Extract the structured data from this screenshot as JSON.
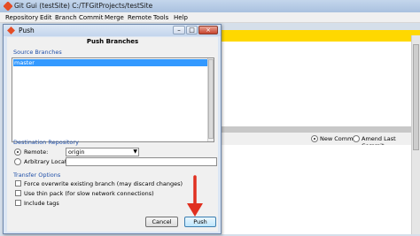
{
  "main_window": {
    "title": "Git Gui (testSite) C:/TFGitProjects/testSite",
    "menu": [
      "Repository",
      "Edit",
      "Branch",
      "Commit",
      "Merge",
      "Remote",
      "Tools",
      "Help"
    ],
    "new_commit_label": "New Commit",
    "amend_label": "Amend Last Commit"
  },
  "dialog": {
    "title": "Push",
    "heading": "Push Branches",
    "source_branches_label": "Source Branches",
    "branches": [
      "master"
    ],
    "destination_label": "Destination Repository",
    "remote_label": "Remote:",
    "remote_value": "origin",
    "arbitrary_label": "Arbitrary Location:",
    "transfer_label": "Transfer Options",
    "options": [
      "Force overwrite existing branch (may discard changes)",
      "Use thin pack (for slow network connections)",
      "Include tags"
    ],
    "cancel_label": "Cancel",
    "push_label": "Push"
  },
  "colors": {
    "accent_blue": "#3399ff",
    "highlight_yellow": "#ffd800",
    "arrow_red": "#e03020"
  }
}
